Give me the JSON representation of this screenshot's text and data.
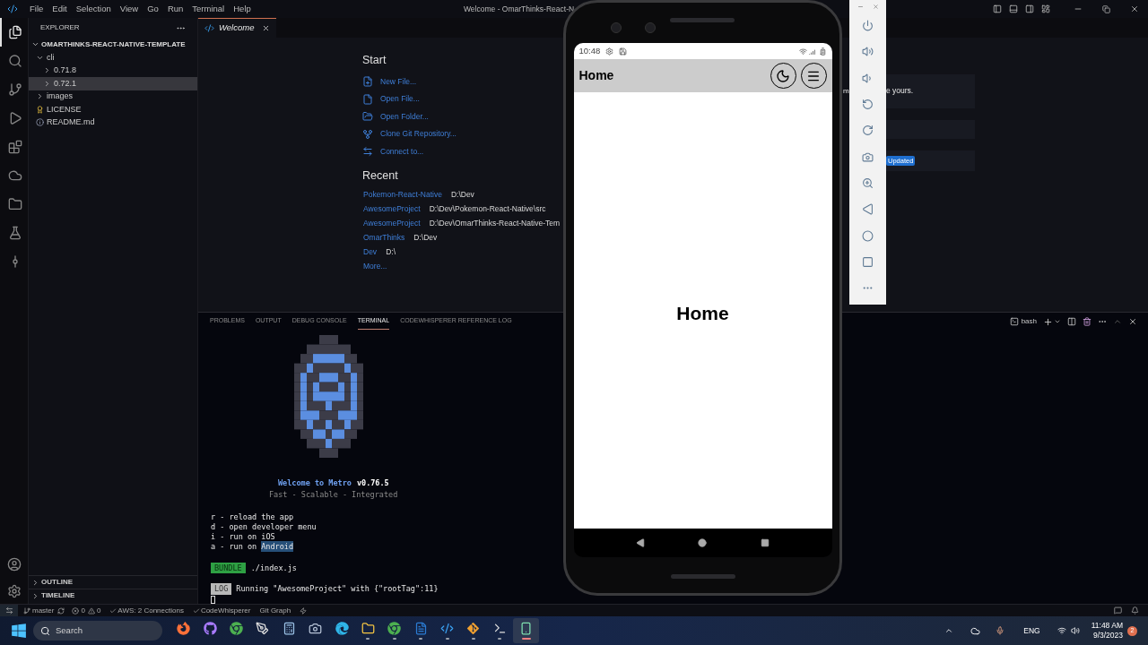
{
  "title_bar": {
    "menus": [
      "File",
      "Edit",
      "Selection",
      "View",
      "Go",
      "Run",
      "Terminal",
      "Help"
    ],
    "title": "Welcome - OmarThinks-React-N"
  },
  "activity_bar": {
    "items": [
      {
        "kind": "files",
        "selected": true
      },
      {
        "kind": "search",
        "selected": false
      },
      {
        "kind": "source-control",
        "selected": false
      },
      {
        "kind": "run",
        "selected": false
      },
      {
        "kind": "extensions",
        "selected": false
      },
      {
        "kind": "aws",
        "selected": false
      },
      {
        "kind": "folder",
        "selected": false
      },
      {
        "kind": "test",
        "selected": false
      },
      {
        "kind": "graph",
        "selected": false
      }
    ]
  },
  "sidebar": {
    "title": "EXPLORER",
    "project": {
      "label": "OMARTHINKS-REACT-NATIVE-TEMPLATE",
      "expanded": true
    },
    "tree": [
      {
        "label": "cli",
        "kind": "folder",
        "expanded": true,
        "selected": false,
        "children": [
          {
            "label": "0.71.8",
            "kind": "folder",
            "expanded": false,
            "selected": false
          },
          {
            "label": "0.72.1",
            "kind": "folder",
            "expanded": false,
            "selected": true
          }
        ]
      },
      {
        "label": "images",
        "kind": "folder",
        "expanded": false,
        "selected": false
      },
      {
        "label": "LICENSE",
        "kind": "license",
        "selected": false
      },
      {
        "label": "README.md",
        "kind": "info",
        "selected": false
      }
    ],
    "sections": [
      {
        "label": "OUTLINE",
        "expanded": false
      },
      {
        "label": "TIMELINE",
        "expanded": false
      }
    ]
  },
  "editor": {
    "tabs": [
      {
        "label": "Welcome",
        "selected": true
      }
    ],
    "start": {
      "heading": "Start",
      "actions": [
        {
          "label": "New File...",
          "kind": "new-file"
        },
        {
          "label": "Open File...",
          "kind": "open-file"
        },
        {
          "label": "Open Folder...",
          "kind": "open-folder"
        },
        {
          "label": "Clone Git Repository...",
          "kind": "clone"
        },
        {
          "label": "Connect to...",
          "kind": "remote"
        }
      ]
    },
    "recent": {
      "heading": "Recent",
      "items": [
        {
          "name": "Pokemon-React-Native",
          "path": "D:\\Dev"
        },
        {
          "name": "AwesomeProject",
          "path": "D:\\Dev\\Pokemon-React-Native\\src"
        },
        {
          "name": "AwesomeProject",
          "path": "D:\\Dev\\OmarThinks-React-Native-Tem"
        },
        {
          "name": "OmarThinks",
          "path": "D:\\Dev"
        },
        {
          "name": "Dev",
          "path": "D:\\"
        }
      ],
      "more": "More..."
    },
    "walkthrough_cards": [
      {
        "kind": "text",
        "left": "m",
        "right": "e yours."
      },
      {
        "kind": "blank"
      },
      {
        "kind": "badge",
        "badge": "Updated"
      }
    ]
  },
  "panel": {
    "tabs": [
      {
        "label": "PROBLEMS",
        "selected": false
      },
      {
        "label": "OUTPUT",
        "selected": false
      },
      {
        "label": "DEBUG CONSOLE",
        "selected": false
      },
      {
        "label": "TERMINAL",
        "selected": true
      },
      {
        "label": "CODEWHISPERER REFERENCE LOG",
        "selected": false
      }
    ],
    "shell": "bash",
    "terminal": {
      "banner_title": "Welcome to Metro",
      "banner_version": "v0.76.5",
      "banner_tagline": "Fast - Scalable - Integrated",
      "shortcuts": [
        {
          "text": "r - reload the app"
        },
        {
          "text": "d - open developer menu"
        },
        {
          "text": "i - run on iOS"
        },
        {
          "text": "a - run on",
          "selection": "Android"
        }
      ],
      "bundle": {
        "tag": "BUNDLE",
        "path": "./index.js"
      },
      "log": {
        "tag": "LOG",
        "message": "Running \"AwesomeProject\" with {\"rootTag\":11}"
      }
    }
  },
  "status_bar": {
    "branch": "master",
    "errors": "0",
    "warnings": "0",
    "items": [
      "AWS: 2 Connections",
      "CodeWhisperer",
      "Git Graph"
    ]
  },
  "emulator": {
    "time": "10:48",
    "app_title": "Home",
    "screen_text": "Home"
  },
  "taskbar": {
    "search_placeholder": "Search",
    "apps": [
      {
        "kind": "firefox",
        "running": false,
        "selected": false
      },
      {
        "kind": "github",
        "running": false,
        "selected": false
      },
      {
        "kind": "chrome",
        "running": false,
        "selected": false
      },
      {
        "kind": "vector",
        "running": false,
        "selected": false
      },
      {
        "kind": "calculator",
        "running": false,
        "selected": false
      },
      {
        "kind": "camera",
        "running": false,
        "selected": false
      },
      {
        "kind": "edge",
        "running": false,
        "selected": false
      },
      {
        "kind": "folder",
        "running": true,
        "selected": false
      },
      {
        "kind": "chrome",
        "running": true,
        "selected": false
      },
      {
        "kind": "word",
        "running": true,
        "selected": false
      },
      {
        "kind": "code",
        "running": true,
        "selected": false
      },
      {
        "kind": "git",
        "running": true,
        "selected": false
      },
      {
        "kind": "terminal",
        "running": true,
        "selected": false
      },
      {
        "kind": "phone",
        "running": true,
        "selected": true
      }
    ],
    "language": "ENG",
    "time": "11:48 AM",
    "date": "9/3/2023",
    "notifications": "2"
  }
}
